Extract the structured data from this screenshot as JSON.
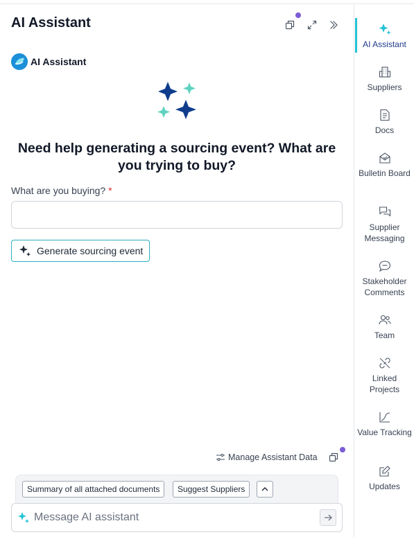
{
  "panel": {
    "title": "AI Assistant",
    "brand_name": "AI Assistant"
  },
  "prompt": {
    "heading": "Need help generating a sourcing event? What are you trying to buy?",
    "field_label": "What are you buying?",
    "required_mark": "*",
    "input_value": "",
    "generate_label": "Generate sourcing event"
  },
  "footer": {
    "manage_label": "Manage Assistant Data",
    "suggestions": [
      "Summary of all attached documents",
      "Suggest Suppliers"
    ],
    "message_placeholder": "Message AI assistant"
  },
  "rail": {
    "items": [
      {
        "label": "AI Assistant",
        "icon": "sparkle-icon",
        "active": true
      },
      {
        "label": "Suppliers",
        "icon": "building-icon"
      },
      {
        "label": "Docs",
        "icon": "document-icon"
      },
      {
        "label": "Bulletin Board",
        "icon": "bulletin-icon"
      },
      {
        "label": "Supplier Messaging",
        "icon": "chat-bubbles-icon"
      },
      {
        "label": "Stakeholder Comments",
        "icon": "comment-icon"
      },
      {
        "label": "Team",
        "icon": "team-icon"
      },
      {
        "label": "Linked Projects",
        "icon": "link-icon"
      },
      {
        "label": "Value Tracking",
        "icon": "line-chart-icon"
      },
      {
        "label": "Updates",
        "icon": "edit-icon"
      }
    ]
  },
  "colors": {
    "accent": "#22c2d4",
    "navy": "#0f3d8c",
    "mint": "#5fd3c0",
    "notification": "#7c5cd6",
    "required": "#dc2626"
  }
}
